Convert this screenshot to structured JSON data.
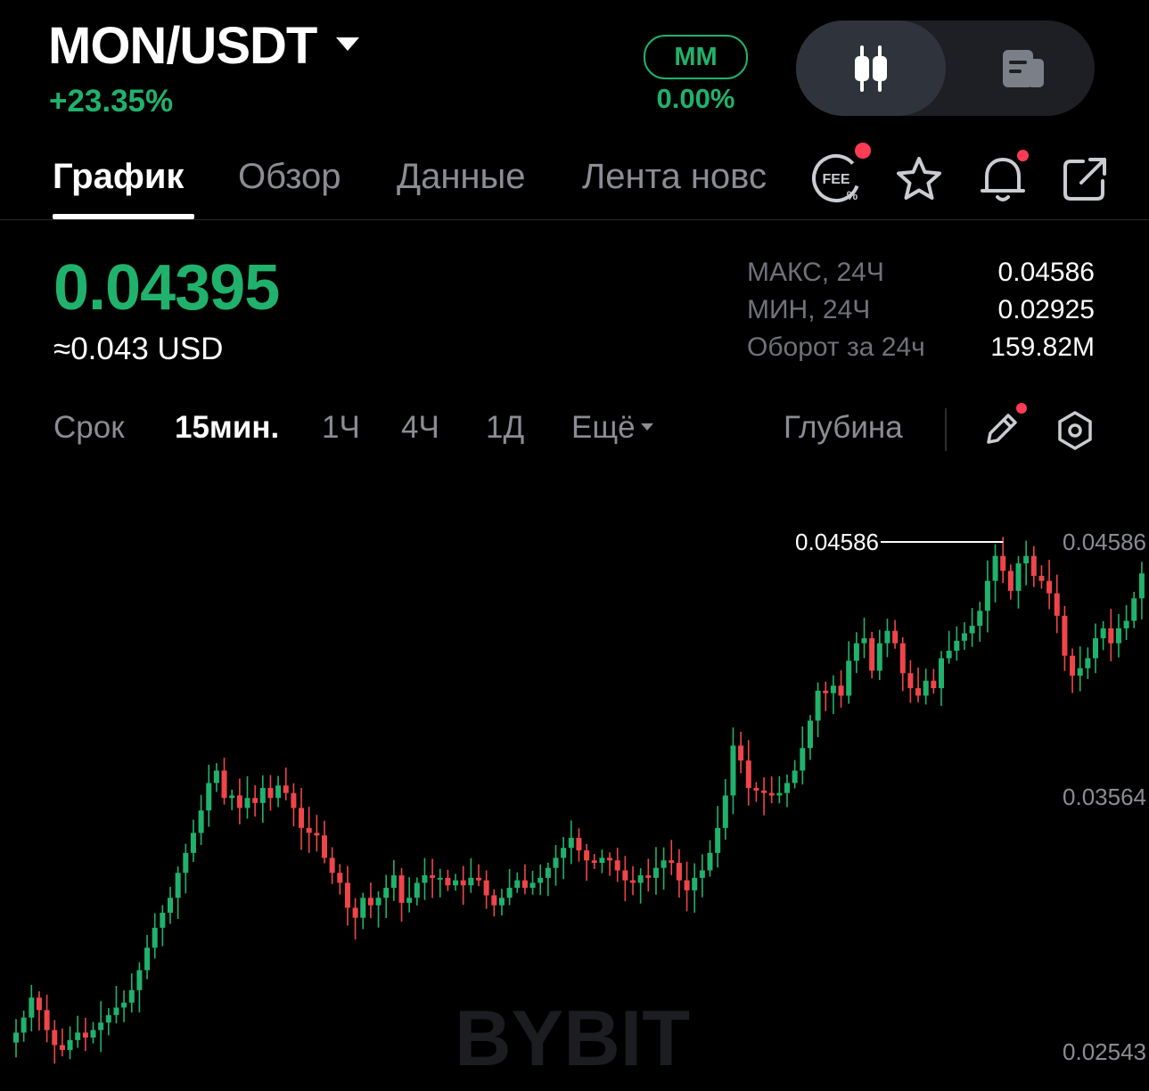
{
  "header": {
    "pair": "MON/USDT",
    "change": "+23.35%",
    "mm_label": "MM",
    "mm_value": "0.00%"
  },
  "view_toggle": {
    "active": "candles-icon",
    "inactive": "book-icon"
  },
  "tabs": [
    "График",
    "Обзор",
    "Данные",
    "Лента новс"
  ],
  "active_tab": "График",
  "price": {
    "last": "0.04395",
    "usd": "≈0.043 USD",
    "stats": [
      {
        "label": "МАКС, 24Ч",
        "value": "0.04586"
      },
      {
        "label": "МИН, 24Ч",
        "value": "0.02925"
      },
      {
        "label": "Оборот за 24ч",
        "value": "159.82M"
      }
    ]
  },
  "timeframes": {
    "label": "Срок",
    "options": [
      "15мин.",
      "1Ч",
      "4Ч",
      "1Д"
    ],
    "active": "15мин.",
    "more": "Ещё",
    "depth": "Глубина"
  },
  "colors": {
    "up": "#20b26c",
    "down": "#ef454a",
    "accent_dot": "#ff3b55"
  },
  "chart_data": {
    "type": "candlestick",
    "y_axis_labels": [
      "0.04586",
      "0.03564",
      "0.02543"
    ],
    "high_marker": "0.04586",
    "watermark": "BYBIT",
    "closes": [
      0.0262,
      0.0268,
      0.0276,
      0.0271,
      0.0263,
      0.0257,
      0.0255,
      0.0259,
      0.0262,
      0.026,
      0.0263,
      0.0266,
      0.0269,
      0.0272,
      0.0274,
      0.0279,
      0.0287,
      0.0296,
      0.0304,
      0.031,
      0.0316,
      0.0326,
      0.0334,
      0.0342,
      0.0351,
      0.0362,
      0.0367,
      0.0356,
      0.0357,
      0.0352,
      0.0356,
      0.0354,
      0.036,
      0.0356,
      0.0361,
      0.0358,
      0.0352,
      0.0344,
      0.0342,
      0.0341,
      0.0332,
      0.0326,
      0.0322,
      0.0312,
      0.0308,
      0.0316,
      0.0313,
      0.0316,
      0.032,
      0.0325,
      0.0314,
      0.0316,
      0.0322,
      0.0325,
      0.0324,
      0.0324,
      0.0321,
      0.0323,
      0.0321,
      0.0324,
      0.0323,
      0.0317,
      0.0313,
      0.0316,
      0.032,
      0.0323,
      0.032,
      0.0322,
      0.0324,
      0.0328,
      0.0332,
      0.0336,
      0.034,
      0.0335,
      0.0331,
      0.033,
      0.0332,
      0.0331,
      0.0327,
      0.0323,
      0.0322,
      0.0325,
      0.0324,
      0.0328,
      0.0331,
      0.033,
      0.0323,
      0.0319,
      0.0324,
      0.0327,
      0.0334,
      0.0344,
      0.0357,
      0.0377,
      0.0371,
      0.036,
      0.0359,
      0.0358,
      0.0357,
      0.0358,
      0.0362,
      0.0367,
      0.0376,
      0.0387,
      0.0399,
      0.0398,
      0.0401,
      0.0397,
      0.0411,
      0.0418,
      0.042,
      0.0407,
      0.0418,
      0.0423,
      0.0418,
      0.0406,
      0.04,
      0.0397,
      0.0403,
      0.04,
      0.0412,
      0.0415,
      0.0419,
      0.0422,
      0.0425,
      0.0431,
      0.0443,
      0.0453,
      0.0447,
      0.0439,
      0.045,
      0.0453,
      0.0445,
      0.0443,
      0.0438,
      0.0429,
      0.0413,
      0.0405,
      0.0408,
      0.0412,
      0.042,
      0.0424,
      0.0418,
      0.0424,
      0.0427,
      0.0436,
      0.0446
    ]
  }
}
